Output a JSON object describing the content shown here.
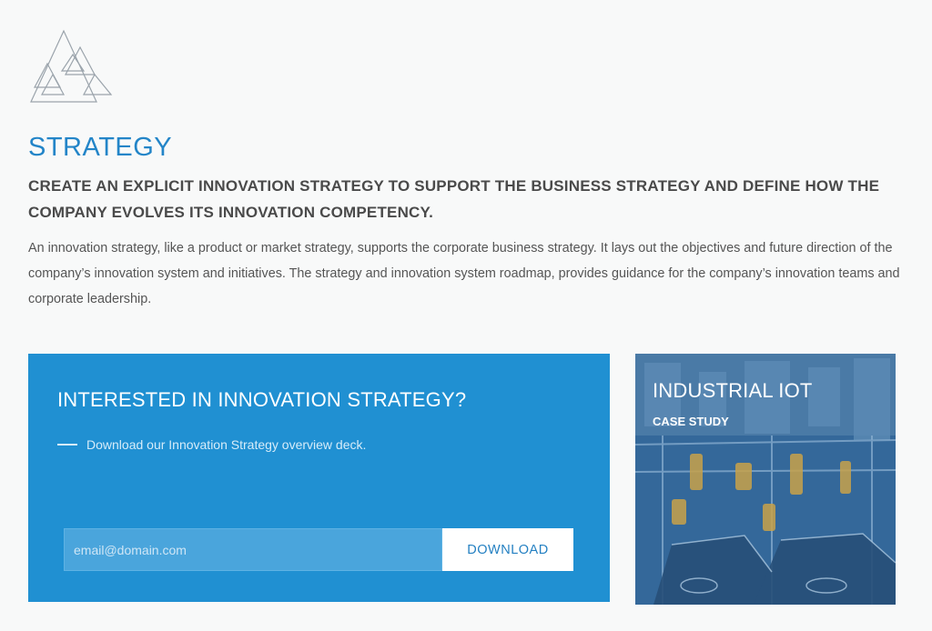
{
  "section": {
    "title": "STRATEGY",
    "headline": "CREATE AN EXPLICIT INNOVATION STRATEGY TO SUPPORT THE BUSINESS STRATEGY AND DEFINE HOW THE COMPANY EVOLVES ITS INNOVATION COMPETENCY.",
    "body": "An innovation strategy, like a product or market strategy, supports the corporate business strategy. It lays out the objectives and future direction of the company’s innovation system and initiatives. The strategy and innovation system roadmap, provides guidance for the company’s innovation teams and corporate leadership."
  },
  "cta": {
    "heading": "INTERESTED IN INNOVATION STRATEGY?",
    "subline": "Download our Innovation Strategy overview deck.",
    "email_placeholder": "email@domain.com",
    "button_label": "DOWNLOAD"
  },
  "case_study": {
    "title": "INDUSTRIAL IOT",
    "label": "CASE STUDY"
  },
  "colors": {
    "accent": "#2385c8",
    "panel": "#2090d2"
  },
  "icons": {
    "logo": "triangles-logo-icon"
  }
}
